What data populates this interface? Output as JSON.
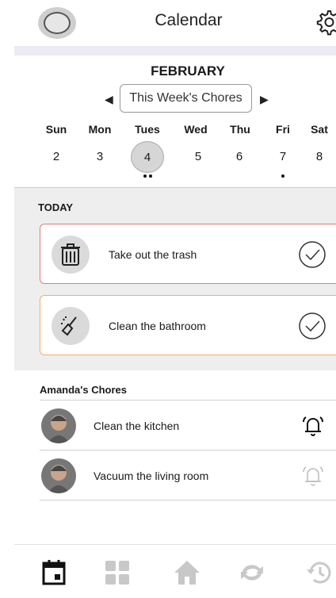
{
  "header": {
    "title": "Calendar",
    "avatar_icon": "profile-avatar-icon",
    "settings_icon": "gear-icon"
  },
  "calendar": {
    "month": "FEBRUARY",
    "week_label": "This Week's Chores",
    "prev_icon": "◀",
    "next_icon": "▶",
    "days": [
      {
        "name": "Sun",
        "num": "2"
      },
      {
        "name": "Mon",
        "num": "3"
      },
      {
        "name": "Tues",
        "num": "4"
      },
      {
        "name": "Wed",
        "num": "5"
      },
      {
        "name": "Thu",
        "num": "6"
      },
      {
        "name": "Fri",
        "num": "7"
      },
      {
        "name": "Sat",
        "num": "8"
      }
    ],
    "selected_day": "Tues"
  },
  "today": {
    "label": "TODAY",
    "chores": [
      {
        "text": "Take out the trash",
        "icon": "trash-can-icon",
        "status_icon": "check-circle-icon",
        "border_color": "#e27a7a"
      },
      {
        "text": "Clean the bathroom",
        "icon": "cleaning-brush-icon",
        "status_icon": "check-circle-icon",
        "border_color": "#f0b06a"
      }
    ]
  },
  "amanda": {
    "title": "Amanda's Chores",
    "chores": [
      {
        "text": "Clean the kitchen",
        "icon": "bell-icon",
        "bell_active": true
      },
      {
        "text": "Vacuum the living room",
        "icon": "bell-icon",
        "bell_active": false
      }
    ]
  },
  "nav": {
    "items": [
      {
        "icon": "calendar-icon",
        "active": true
      },
      {
        "icon": "grid-icon",
        "active": false
      },
      {
        "icon": "home-icon",
        "active": false
      },
      {
        "icon": "sync-icon",
        "active": false
      },
      {
        "icon": "history-icon",
        "active": false
      }
    ]
  }
}
